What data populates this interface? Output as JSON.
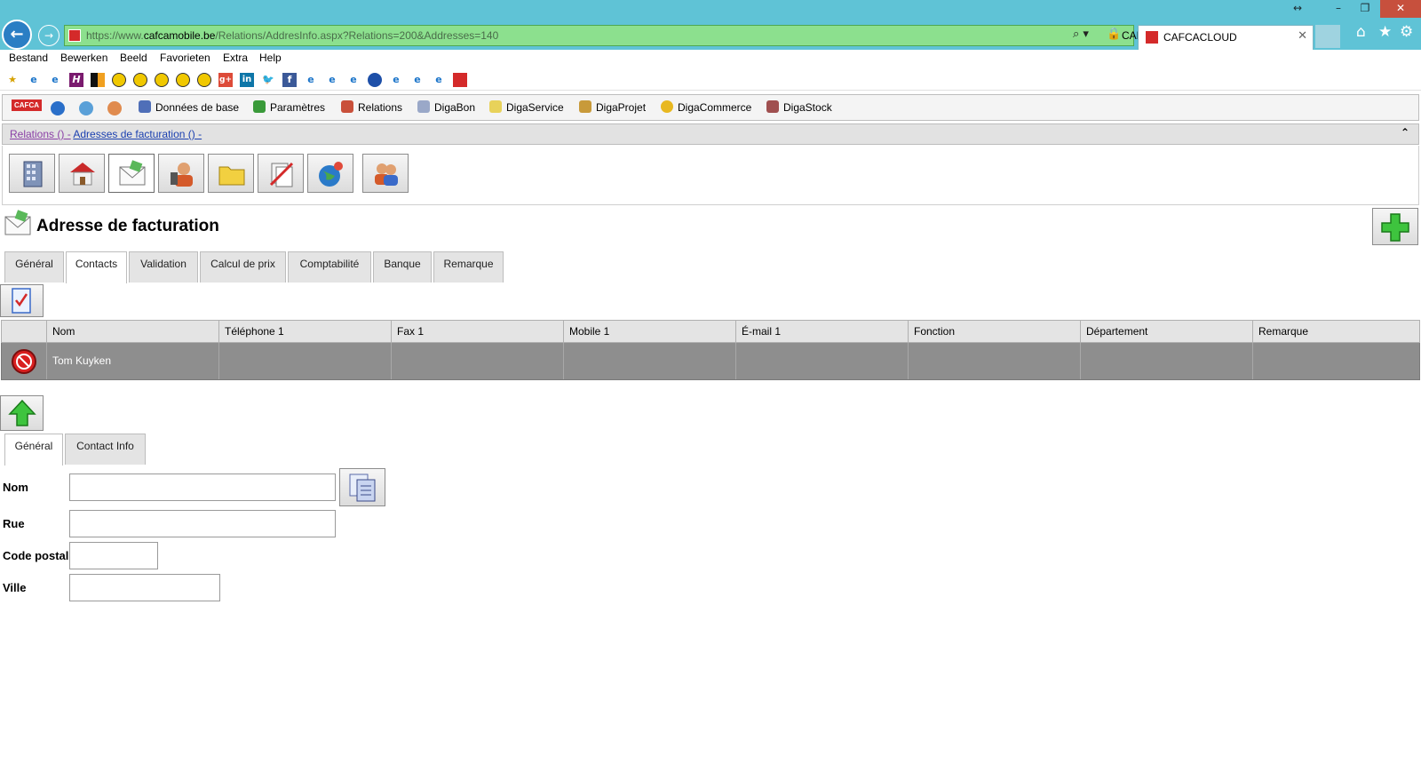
{
  "browser": {
    "url_prefix": "https://www.",
    "url_host": "cafcamobile.be",
    "url_path": "/Relations/AddresInfo.aspx?Relations=200&Addresses=140",
    "site_identity": "CAFCA [BE]",
    "tab_title": "CAFCACLOUD",
    "window_controls": [
      "↔",
      "–",
      "❐",
      "✕"
    ]
  },
  "menu": [
    "Bestand",
    "Bewerken",
    "Beeld",
    "Favorieten",
    "Extra",
    "Help"
  ],
  "app_toolbar": {
    "logo_text": "CAFCA",
    "items": [
      "Données de base",
      "Paramètres",
      "Relations",
      "DigaBon",
      "DigaService",
      "DigaProjet",
      "DigaCommerce",
      "DigaStock"
    ]
  },
  "breadcrumb": {
    "part1": "Relations () -",
    "part2": "Adresses de facturation () -"
  },
  "page": {
    "title": "Adresse de facturation"
  },
  "top_tabs": [
    "Général",
    "Contacts",
    "Validation",
    "Calcul de prix",
    "Comptabilité",
    "Banque",
    "Remarque"
  ],
  "grid": {
    "columns": [
      "Nom",
      "Téléphone 1",
      "Fax 1",
      "Mobile 1",
      "É-mail 1",
      "Fonction",
      "Département",
      "Remarque"
    ],
    "rows": [
      [
        "Tom Kuyken",
        "",
        "",
        "",
        "",
        "",
        "",
        ""
      ]
    ]
  },
  "bottom_tabs": [
    "Général",
    "Contact Info"
  ],
  "form": {
    "nom_label": "Nom",
    "rue_label": "Rue",
    "code_postal_label": "Code postal",
    "ville_label": "Ville",
    "nom_value": "",
    "rue_value": "",
    "code_postal_value": "",
    "ville_value": ""
  },
  "colors": {
    "chrome": "#5fc3d6",
    "address_bar": "#8ce08e",
    "selected_row": "#8e8e8e"
  }
}
